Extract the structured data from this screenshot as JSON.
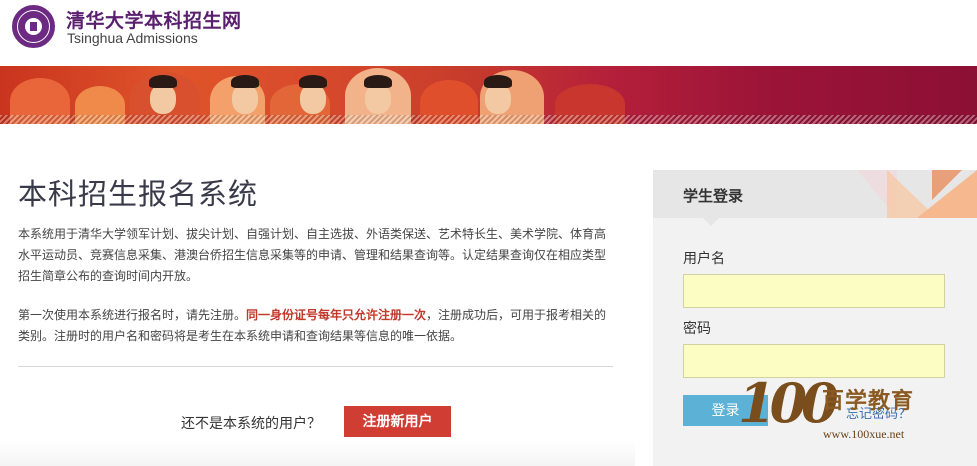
{
  "header": {
    "brand_cn": "清华大学本科招生网",
    "brand_en": "Tsinghua Admissions",
    "logo_icon": "tsinghua-seal-icon"
  },
  "colors": {
    "brand_purple": "#5a1f6e",
    "banner_red": "#c9341f",
    "register_red": "#cf3d33",
    "login_blue": "#5bb1d6",
    "input_yellow": "#fbfdc3",
    "warning_red": "#c0392b"
  },
  "main": {
    "title": "本科招生报名系统",
    "description_1": "本系统用于清华大学领军计划、拔尖计划、自强计划、自主选拔、外语类保送、艺术特长生、美术学院、体育高水平运动员、竞赛信息采集、港澳台侨招生信息采集等的申请、管理和结果查询等。认定结果查询仅在相应类型招生简章公布的查询时间内开放。",
    "description_2_before": "第一次使用本系统进行报名时，请先注册。",
    "description_2_warning": "同一身份证号每年只允许注册一次",
    "description_2_after": "，注册成功后，可用于报考相关的类别。注册时的用户名和密码将是考生在本系统申请和查询结果等信息的唯一依据。",
    "not_user_text": "还不是本系统的用户？",
    "register_label": "注册新用户"
  },
  "login": {
    "title": "学生登录",
    "username_label": "用户名",
    "username_value": "",
    "password_label": "密码",
    "password_value": "",
    "submit_label": "登录",
    "forgot_label": "忘记密码？"
  },
  "watermark": {
    "number": "100",
    "cn": "百学教育",
    "url": "www.100xue.net"
  }
}
